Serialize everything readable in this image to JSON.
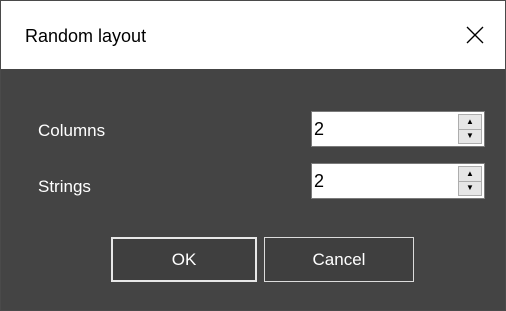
{
  "window": {
    "title": "Random layout",
    "close_icon": "close-icon"
  },
  "form": {
    "columns": {
      "label": "Columns",
      "value": "2"
    },
    "strings": {
      "label": "Strings",
      "value": "2"
    }
  },
  "buttons": {
    "ok_label": "OK",
    "cancel_label": "Cancel"
  },
  "spinner": {
    "up_glyph": "▲",
    "down_glyph": "▼"
  },
  "colors": {
    "dialog_background": "#444444",
    "titlebar_background": "#ffffff",
    "text_on_dark": "#ffffff"
  }
}
